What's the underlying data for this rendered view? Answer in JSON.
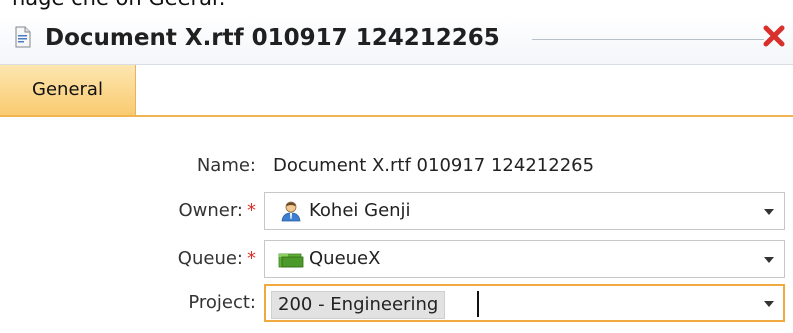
{
  "caption": "nage cne on Geerar.",
  "window": {
    "title": "Document X.rtf 010917 124212265"
  },
  "tabs": [
    {
      "label": "General"
    }
  ],
  "form": {
    "name": {
      "label": "Name:",
      "value": "Document X.rtf 010917 124212265"
    },
    "owner": {
      "label": "Owner:",
      "required_marker": "*",
      "value": "Kohei Genji",
      "icon": "user-icon"
    },
    "queue": {
      "label": "Queue:",
      "required_marker": "*",
      "value": "QueueX",
      "icon": "queue-icon"
    },
    "project": {
      "label": "Project:",
      "value": "200 - Engineering"
    }
  },
  "colors": {
    "tab_active_top": "#fde6b0",
    "tab_active_bottom": "#f9cb70",
    "active_border": "#f0a93e",
    "required": "#d9302b",
    "close": "#d9302b"
  }
}
